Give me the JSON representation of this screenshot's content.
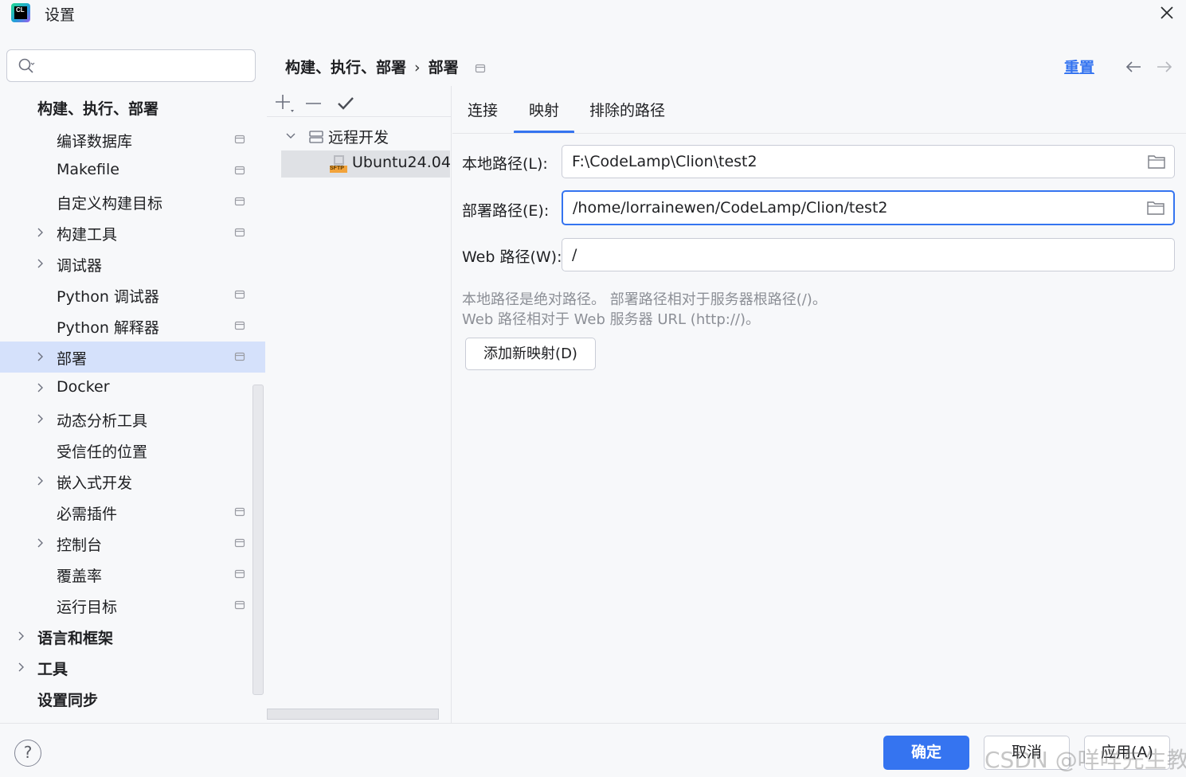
{
  "window": {
    "title": "设置",
    "app_icon_text": "CL"
  },
  "search": {
    "value": "",
    "placeholder": ""
  },
  "sidebar": {
    "items": [
      {
        "label": "构建、执行、部署",
        "bold": true
      },
      {
        "label": "编译数据库"
      },
      {
        "label": "Makefile"
      },
      {
        "label": "自定义构建目标"
      },
      {
        "label": "构建工具"
      },
      {
        "label": "调试器"
      },
      {
        "label": "Python 调试器"
      },
      {
        "label": "Python 解释器"
      },
      {
        "label": "部署",
        "selected": true
      },
      {
        "label": "Docker"
      },
      {
        "label": "动态分析工具"
      },
      {
        "label": "受信任的位置"
      },
      {
        "label": "嵌入式开发"
      },
      {
        "label": "必需插件"
      },
      {
        "label": "控制台"
      },
      {
        "label": "覆盖率"
      },
      {
        "label": "运行目标"
      },
      {
        "label": "语言和框架",
        "bold": true
      },
      {
        "label": "工具",
        "bold": true
      },
      {
        "label": "设置同步",
        "bold": true
      }
    ]
  },
  "header": {
    "breadcrumb": [
      "构建、执行、部署",
      "部署"
    ],
    "separator": "›",
    "reset_label": "重置"
  },
  "servers": {
    "group_label": "远程开发",
    "server_label": "Ubuntu24.04",
    "server_badge": "SFTP"
  },
  "tabs": [
    "连接",
    "映射",
    "排除的路径"
  ],
  "active_tab": "映射",
  "mapping": {
    "local_path_label": "本地路径(L):",
    "local_path_value": "F:\\CodeLamp\\Clion\\test2",
    "deploy_path_label": "部署路径(E):",
    "deploy_path_value": "/home/lorrainewen/CodeLamp/Clion/test2",
    "web_path_label": "Web 路径(W):",
    "web_path_value": "/",
    "hint_line1": "本地路径是绝对路径。 部署路径相对于服务器根路径(/)。",
    "hint_line2": "Web 路径相对于 Web 服务器 URL (http://)。",
    "add_mapping_label": "添加新映射(D)"
  },
  "footer": {
    "help_label": "?",
    "ok_label": "确定",
    "cancel_label": "取消",
    "apply_label": "应用(A)"
  },
  "watermark": "CSDN @咩咩先生教",
  "colors": {
    "accent": "#3574f0",
    "selection": "#d5e1fb",
    "background": "#f7f8fa"
  }
}
